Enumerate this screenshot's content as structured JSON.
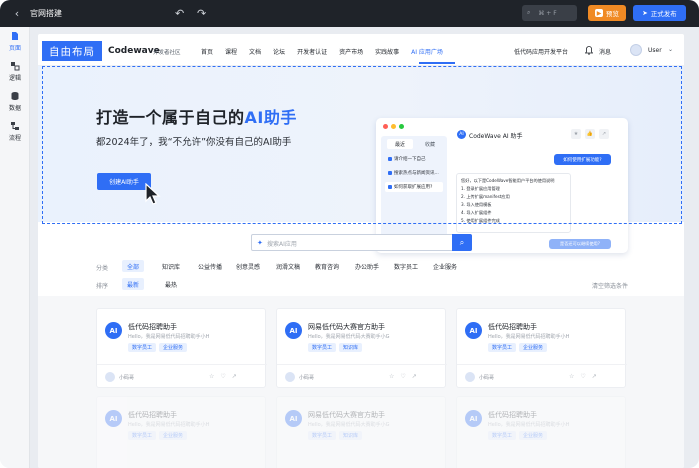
{
  "topbar": {
    "title": "官网搭建",
    "search_shortcut": "⌘ + F",
    "preview_label": "预览",
    "publish_label": "正式发布"
  },
  "rail": {
    "items": [
      {
        "label": "页面",
        "icon": "page-icon",
        "active": true
      },
      {
        "label": "逻辑",
        "icon": "logic-icon",
        "active": false
      },
      {
        "label": "数据",
        "icon": "database-icon",
        "active": false
      },
      {
        "label": "流程",
        "icon": "flow-icon",
        "active": false
      }
    ]
  },
  "site": {
    "logo": "自由布局",
    "brand": "Codewave",
    "brand_sub": "开发者社区",
    "nav": [
      "首页",
      "课程",
      "文档",
      "论坛",
      "开发者认证",
      "资产市场",
      "实践故事",
      "AI 应用广场"
    ],
    "nav_active_index": 7,
    "nav_right": "低代码应用开发平台",
    "messages": "消息",
    "user": "User"
  },
  "hero": {
    "title_prefix": "打造一个属于自己的",
    "title_ai": "AI助手",
    "subtitle": "都2024年了，我“不允许”你没有自己的AI助手",
    "button": "创建AI助手"
  },
  "mock": {
    "tabs": [
      "最近",
      "收藏"
    ],
    "list": [
      "请介绍一下自己",
      "搜索热点与新闻资讯...",
      "如何获取扩展应用?"
    ],
    "ai_title": "CodeWave AI 助手",
    "question": "如何使用扩展功能?",
    "answer_lines": [
      "您好，以下是CodeWave智能用户平台的使用说明",
      "1. 登录扩展应用管理",
      "2. 上传扩展manifest应用",
      "3. 导入使用模板",
      "4. 导入扩展组件",
      "5. 使用扩展组件完成"
    ],
    "followup": "是否还可以继续使用?"
  },
  "search": {
    "placeholder": "搜索AI应用"
  },
  "filters": {
    "category_label": "分类",
    "categories": [
      "全部",
      "知识库",
      "公益传播",
      "创意灵感",
      "润滑文稿",
      "教育咨询",
      "办公助手",
      "数字员工",
      "企业服务"
    ],
    "category_selected": 0,
    "sort_label": "排序",
    "sorts": [
      "最新",
      "最热"
    ],
    "sort_selected": 0,
    "clear": "清空筛选条件"
  },
  "cards": [
    {
      "title": "低代码招聘助手",
      "desc": "Hello，我是网易低代码招聘助手小H",
      "tags": [
        "数字员工",
        "企业服务"
      ],
      "author": "小码哥"
    },
    {
      "title": "网易低代码大赛官方助手",
      "desc": "Hello，我是网易低代码大赛助手小G",
      "tags": [
        "数字员工",
        "知识库"
      ],
      "author": "小码哥"
    },
    {
      "title": "低代码招聘助手",
      "desc": "Hello，我是网易低代码招聘助手小H",
      "tags": [
        "数字员工",
        "企业服务"
      ],
      "author": "小码哥"
    },
    {
      "title": "低代码招聘助手",
      "desc": "Hello，我是网易低代码招聘助手小H",
      "tags": [
        "数字员工",
        "企业服务"
      ],
      "author": ""
    },
    {
      "title": "网易低代码大赛官方助手",
      "desc": "Hello，我是网易低代码大赛助手小G",
      "tags": [
        "数字员工",
        "知识库"
      ],
      "author": ""
    },
    {
      "title": "低代码招聘助手",
      "desc": "Hello，我是网易低代码招聘助手小H",
      "tags": [
        "数字员工",
        "企业服务"
      ],
      "author": ""
    }
  ],
  "colors": {
    "accent": "#2f6ef5",
    "preview": "#f08a24",
    "topbar": "#1f2329"
  }
}
